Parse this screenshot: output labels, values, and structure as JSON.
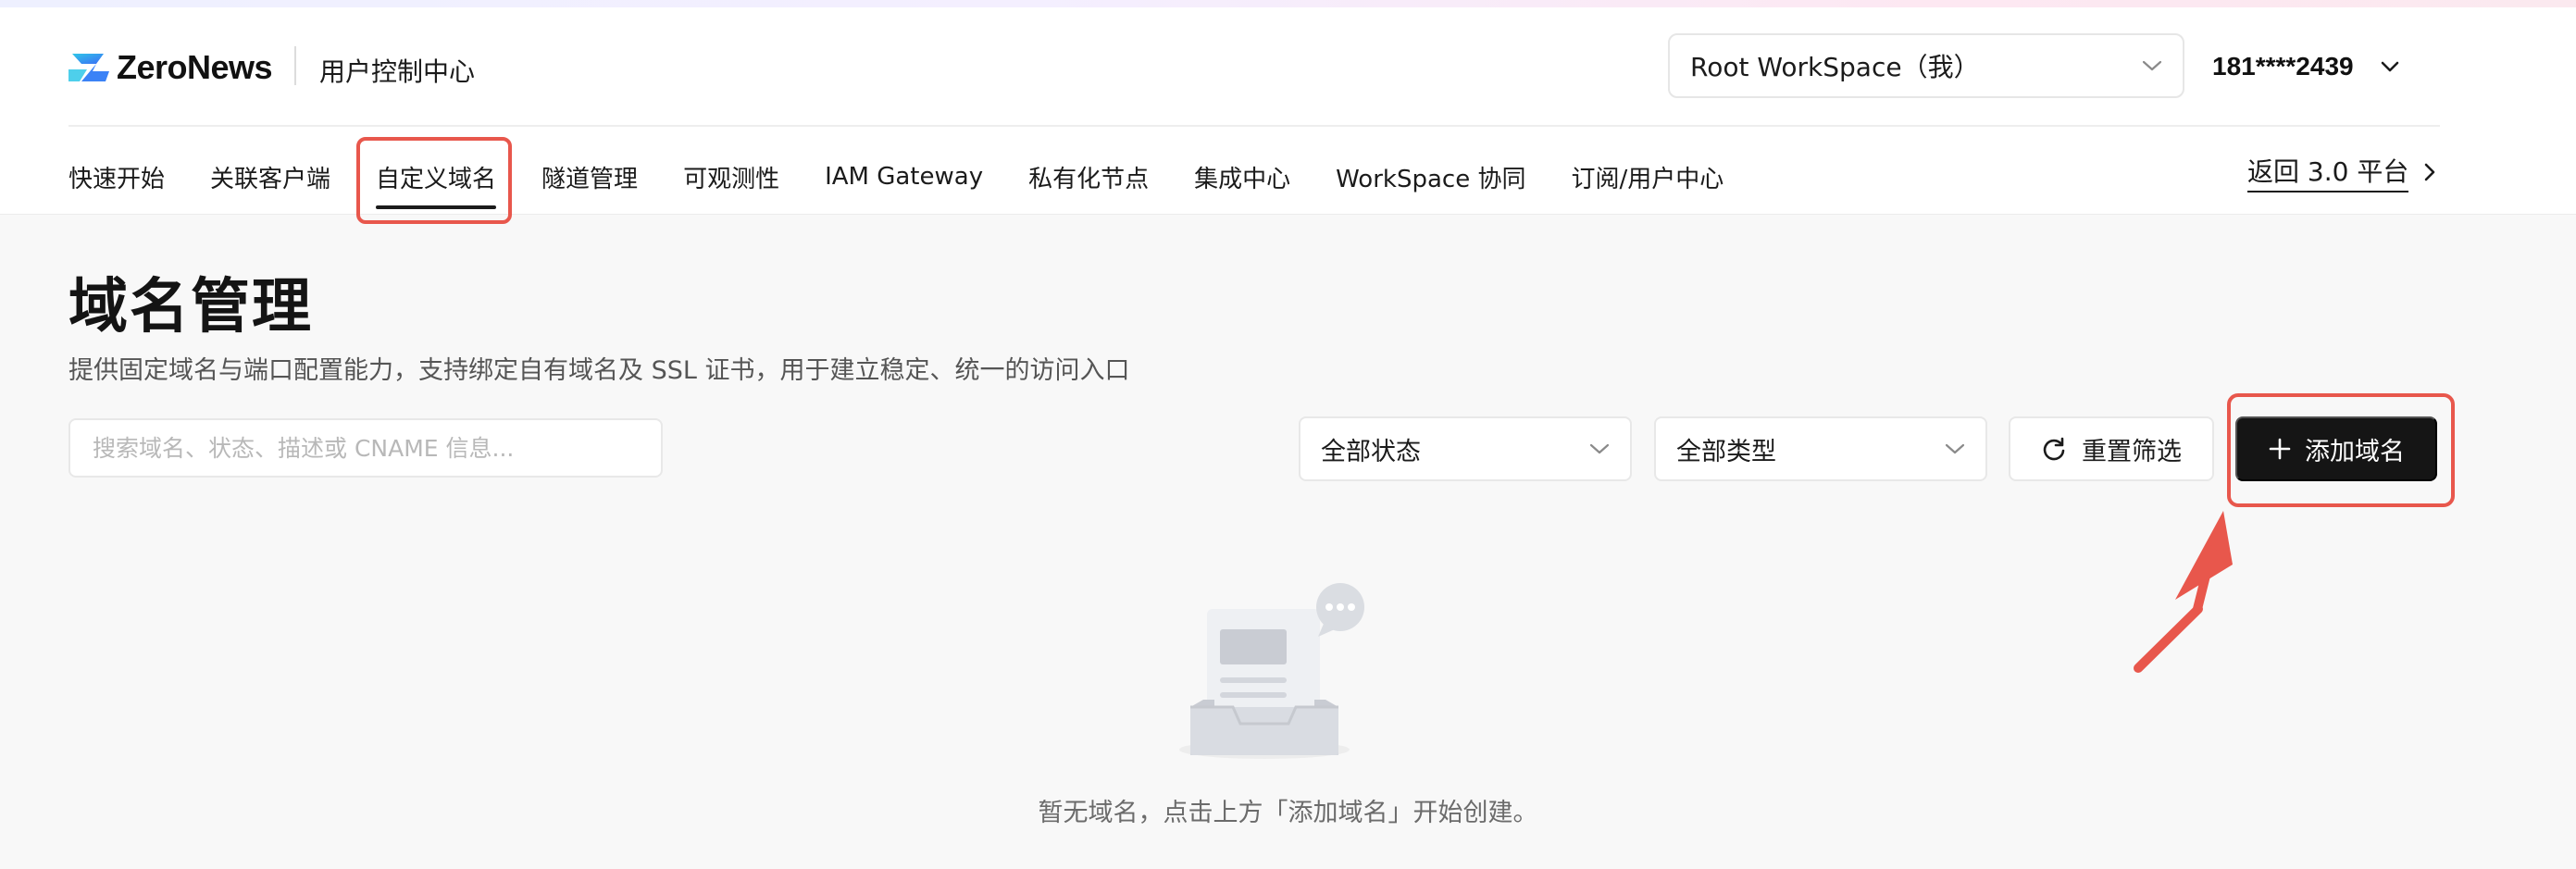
{
  "header": {
    "logo_text": "ZeroNews",
    "console_title": "用户控制中心",
    "workspace_select": {
      "value": "Root WorkSpace（我）"
    },
    "user": {
      "phone": "181****2439"
    }
  },
  "nav": {
    "items": [
      {
        "label": "快速开始"
      },
      {
        "label": "关联客户端"
      },
      {
        "label": "自定义域名",
        "active": true
      },
      {
        "label": "隧道管理"
      },
      {
        "label": "可观测性"
      },
      {
        "label": "IAM Gateway"
      },
      {
        "label": "私有化节点"
      },
      {
        "label": "集成中心"
      },
      {
        "label": "WorkSpace 协同"
      },
      {
        "label": "订阅/用户中心"
      }
    ],
    "back_link": "返回 3.0 平台"
  },
  "page": {
    "title": "域名管理",
    "description": "提供固定域名与端口配置能力，支持绑定自有域名及 SSL 证书，用于建立稳定、统一的访问入口"
  },
  "toolbar": {
    "search_placeholder": "搜索域名、状态、描述或 CNAME 信息...",
    "status_filter": "全部状态",
    "type_filter": "全部类型",
    "reset_label": "重置筛选",
    "add_label": "添加域名"
  },
  "empty_state": {
    "text": "暂无域名，点击上方「添加域名」开始创建。"
  },
  "colors": {
    "accent_dark": "#151515",
    "annotation_red": "#e8574c",
    "logo_blue": "#3b82f6",
    "logo_cyan": "#2fc7e8"
  },
  "icons": {
    "logo": "zeronews-logo-icon",
    "dropdown": "chevron-down-icon",
    "reset": "refresh-icon",
    "add": "plus-icon",
    "back": "chevron-right-icon",
    "empty": "empty-inbox-icon"
  }
}
